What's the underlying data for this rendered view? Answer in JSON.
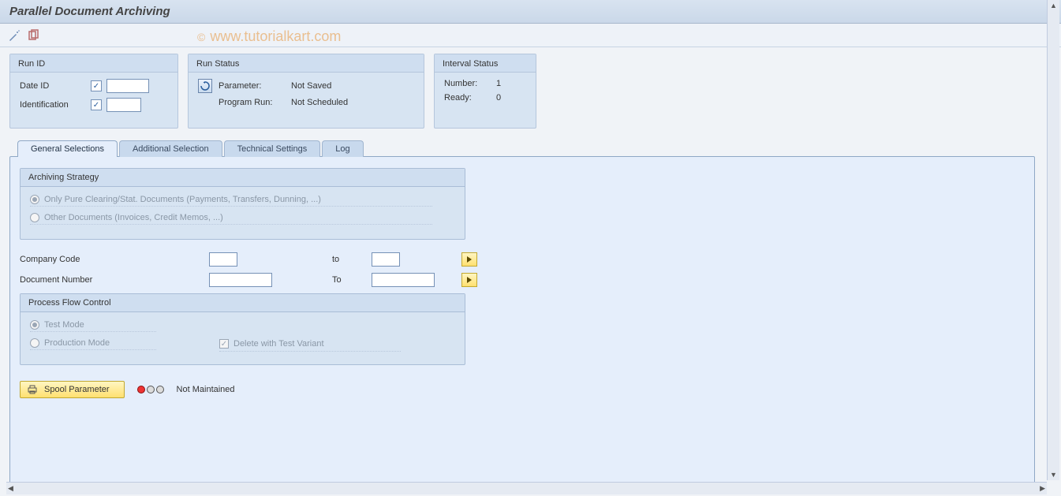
{
  "title": "Parallel Document Archiving",
  "watermark": "© www.tutorialkart.com",
  "run_id": {
    "title": "Run ID",
    "date_id_label": "Date ID",
    "date_id_value": "",
    "ident_label": "Identification",
    "ident_value": ""
  },
  "run_status": {
    "title": "Run Status",
    "param_label": "Parameter:",
    "param_value": "Not Saved",
    "prog_label": "Program Run:",
    "prog_value": "Not Scheduled"
  },
  "interval": {
    "title": "Interval Status",
    "number_label": "Number:",
    "number_value": "1",
    "ready_label": "Ready:",
    "ready_value": "0"
  },
  "tabs": {
    "t1": "General Selections",
    "t2": "Additional Selection",
    "t3": "Technical Settings",
    "t4": "Log"
  },
  "arch": {
    "title": "Archiving Strategy",
    "opt1": "Only Pure Clearing/Stat. Documents (Payments, Transfers, Dunning, ...)",
    "opt2": "Other Documents (Invoices, Credit Memos, ...)"
  },
  "criteria": {
    "company_label": "Company Code",
    "company_to": "to",
    "doc_label": "Document Number",
    "doc_to": "To"
  },
  "pfc": {
    "title": "Process Flow Control",
    "test": "Test Mode",
    "prod": "Production Mode",
    "delvar": "Delete with Test Variant"
  },
  "spool": {
    "button": "Spool Parameter",
    "status": "Not Maintained"
  }
}
